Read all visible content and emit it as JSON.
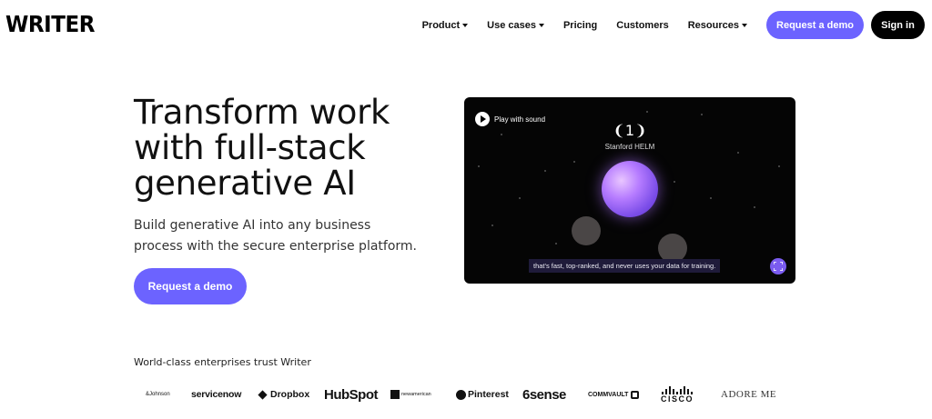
{
  "brand": {
    "logo_text": "WRITER"
  },
  "nav": {
    "items": [
      {
        "label": "Product",
        "has_dropdown": true
      },
      {
        "label": "Use cases",
        "has_dropdown": true
      },
      {
        "label": "Pricing",
        "has_dropdown": false
      },
      {
        "label": "Customers",
        "has_dropdown": false
      },
      {
        "label": "Resources",
        "has_dropdown": true
      }
    ],
    "request_demo_label": "Request a demo",
    "sign_in_label": "Sign in"
  },
  "hero": {
    "headline_lines": [
      "Transform work",
      "with full-stack",
      "generative AI"
    ],
    "subtext_lines": [
      "Build generative AI into any business",
      "process with the secure enterprise platform."
    ],
    "cta_label": "Request a demo"
  },
  "video": {
    "play_label": "Play with sound",
    "rank": "1",
    "rank_label": "Stanford HELM",
    "caption": "that's fast, top-ranked, and never uses your data for training."
  },
  "trust": {
    "title": "World-class enterprises trust Writer",
    "logos": [
      "&Johnson",
      "servicenow",
      "Dropbox",
      "HubSpot",
      "newamerican",
      "Pinterest",
      "6sense",
      "COMMVAULT",
      "CISCO",
      "ADORE ME"
    ]
  },
  "colors": {
    "accent": "#6c63ff",
    "dark": "#000000",
    "video_bg": "#050505",
    "orb": "#b67cff"
  }
}
